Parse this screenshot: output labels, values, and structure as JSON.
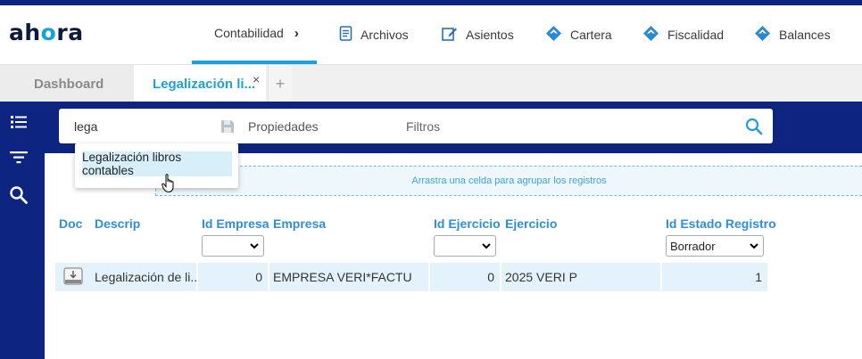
{
  "app": {
    "logo_a": "ah",
    "logo_o": "o",
    "logo_b": "ra"
  },
  "nav": {
    "items": [
      {
        "label": "Contabilidad",
        "chevron": "›"
      },
      {
        "label": "Archivos",
        "icon": "document-icon"
      },
      {
        "label": "Asientos",
        "icon": "edit-icon"
      },
      {
        "label": "Cartera",
        "icon": "diamond-icon"
      },
      {
        "label": "Fiscalidad",
        "icon": "diamond-icon"
      },
      {
        "label": "Balances",
        "icon": "diamond-icon"
      }
    ]
  },
  "tabs": {
    "dashboard": "Dashboard",
    "active": "Legalización li...",
    "close": "×",
    "add": "+"
  },
  "search": {
    "value": "lega",
    "properties_label": "Propiedades",
    "filters_label": "Filtros"
  },
  "suggestion": {
    "item": "Legalización libros contables"
  },
  "group_area": {
    "text": "Arrastra una celda para agrupar los registros"
  },
  "table": {
    "columns": [
      "Doc",
      "Descrip",
      "Id Empresa",
      "Empresa",
      "Id Ejercicio",
      "Ejercicio",
      "Id Estado Registro"
    ],
    "filters": {
      "id_empresa": "",
      "id_ejercicio": "",
      "id_estado": "Borrador"
    },
    "rows": [
      {
        "descrip": "Legalización de li...",
        "id_empresa": "0",
        "empresa": "EMPRESA VERI*FACTU",
        "id_ejercicio": "0",
        "ejercicio": "2025 VERI P",
        "id_estado": "1"
      }
    ]
  },
  "colors": {
    "primary": "#0d2480",
    "accent": "#1ea0d8"
  }
}
